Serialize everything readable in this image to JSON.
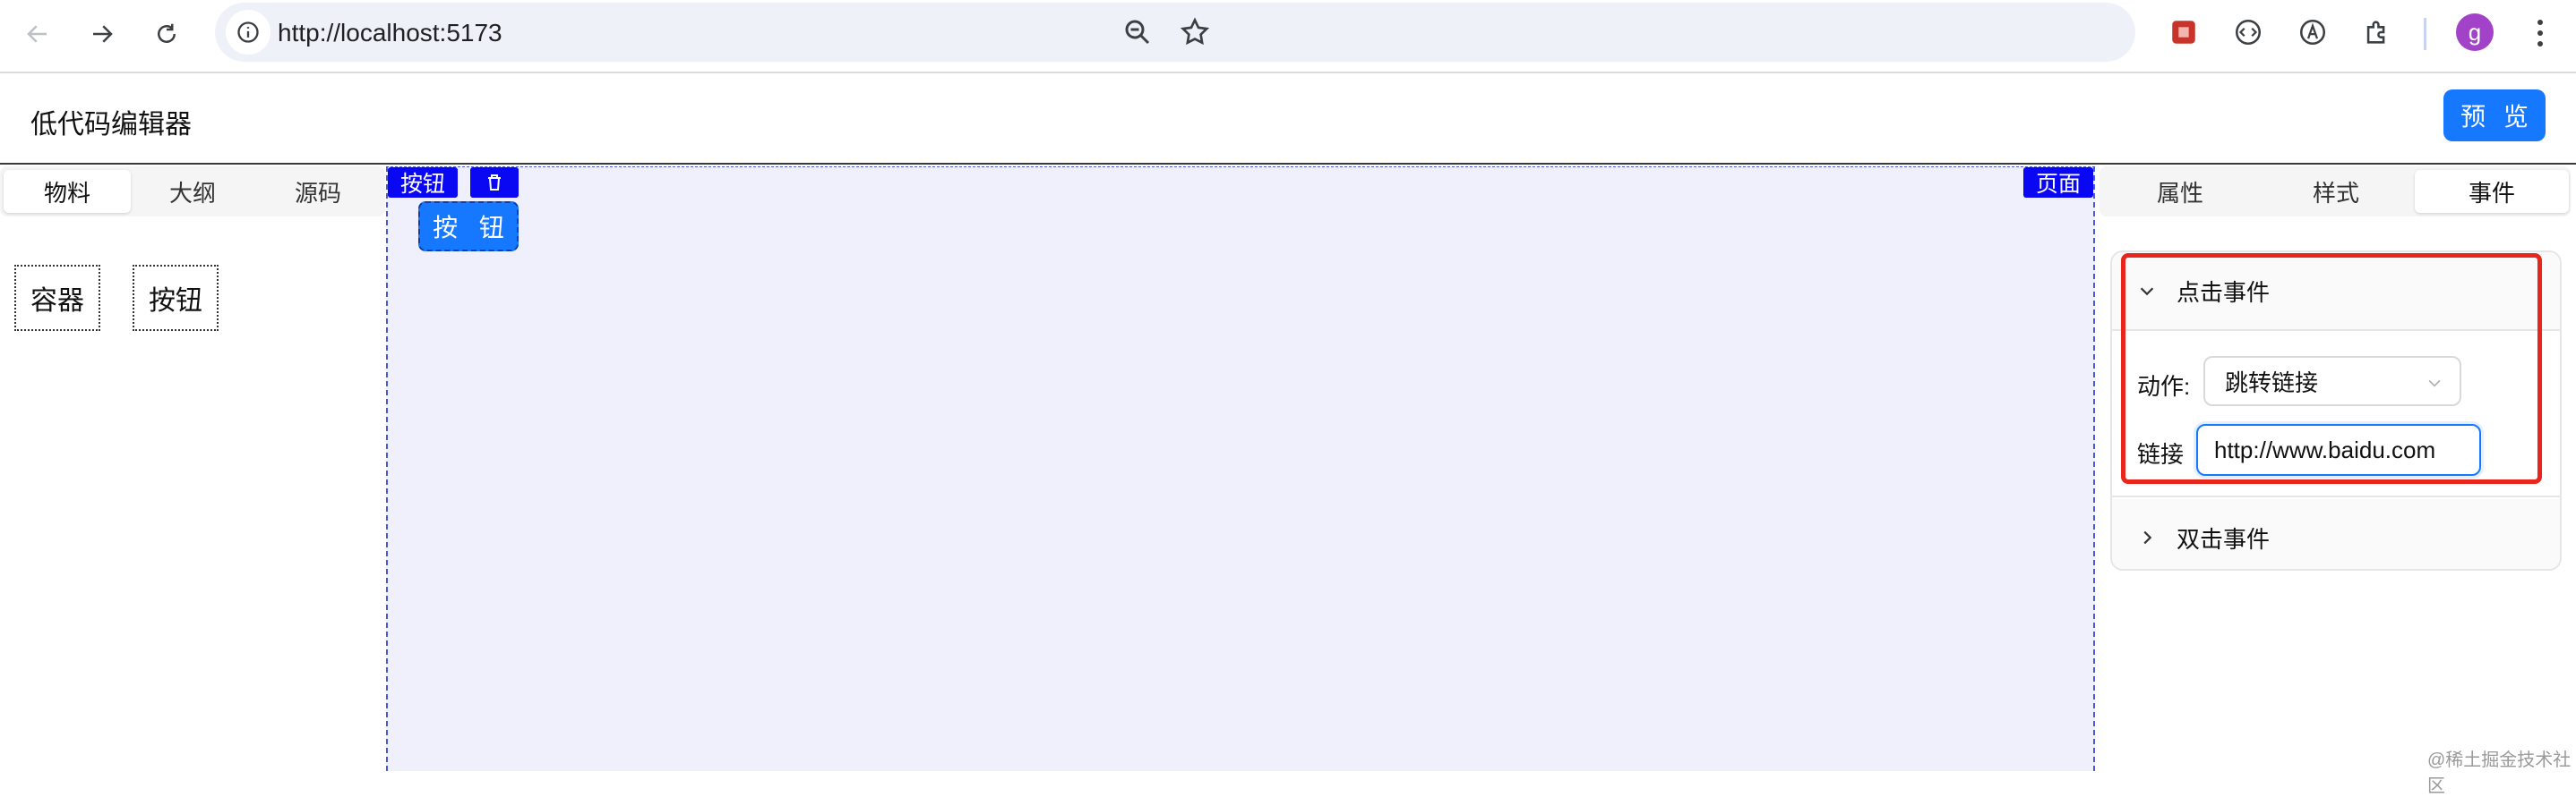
{
  "browser": {
    "url": "http://localhost:5173",
    "avatar_letter": "g"
  },
  "app": {
    "title": "低代码编辑器",
    "preview_label": "预 览"
  },
  "left_panel": {
    "tabs": [
      "物料",
      "大纲",
      "源码"
    ],
    "active_tab": "物料",
    "materials": [
      "容器",
      "按钮"
    ]
  },
  "canvas": {
    "selected_tag": "按钮",
    "page_tag": "页面",
    "button_label": "按 钮",
    "background": "#eff0fb",
    "tag_color": "#0a08f3"
  },
  "right_panel": {
    "tabs": [
      "属性",
      "样式",
      "事件"
    ],
    "active_tab": "事件",
    "events": [
      {
        "title": "点击事件",
        "expanded": true,
        "action_label": "动作:",
        "action_value": "跳转链接",
        "link_label": "链接",
        "link_value": "http://www.baidu.com"
      },
      {
        "title": "双击事件",
        "expanded": false
      }
    ]
  },
  "colors": {
    "primary": "#1677ff",
    "highlight": "#e8261c"
  },
  "watermark": "@稀土掘金技术社区"
}
